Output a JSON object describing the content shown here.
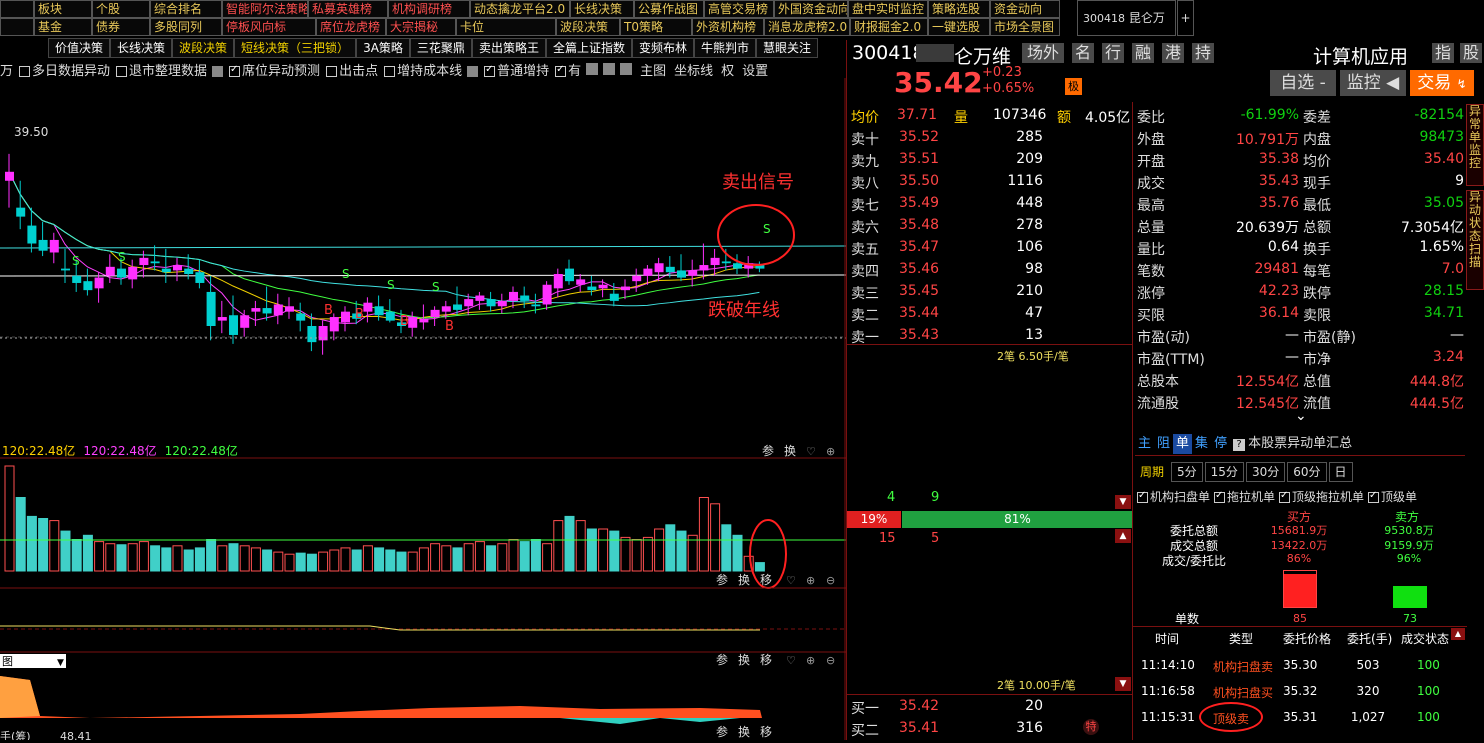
{
  "menu_row1": [
    "",
    "板块",
    "个股",
    "综合排名",
    "智能阿尔法策略",
    "私募英雄榜",
    "机构调研榜",
    "动态擒龙平台2.0",
    "长线决策",
    "公募作战图",
    "高管交易榜",
    "外国资金动向",
    "盘中实时监控",
    "策略选股",
    "资金动向"
  ],
  "menu_row2": [
    "",
    "基金",
    "债券",
    "多股同列",
    "停板风向标",
    "席位龙虎榜",
    "大宗揭秘",
    "卡位",
    "波段决策",
    "T0策略",
    "外资机构榜",
    "消息龙虎榜2.0",
    "财报掘金2.0",
    "一键选股",
    "市场全景图"
  ],
  "menu_red_row1": [
    4,
    5,
    6
  ],
  "menu_red_row2": [
    4,
    5,
    6
  ],
  "stock_tab": {
    "code": "300418",
    "name": "昆仑万维",
    "plus": "+"
  },
  "strategy_buttons": [
    "价值决策",
    "长线决策",
    "波段决策",
    "短线决策（三把锁）",
    "3A策略",
    "三花聚鼎",
    "卖出策略王",
    "全篇上证指数",
    "变频布林",
    "牛熊判市",
    "慧眼关注"
  ],
  "strategy_yellow": [
    2,
    3
  ],
  "options": [
    {
      "label": "多日数据异动",
      "on": false
    },
    {
      "label": "退市整理数据",
      "on": false
    },
    {
      "label": "席位异动预测",
      "on": true
    },
    {
      "label": "出击点",
      "on": false
    },
    {
      "label": "增持成本线",
      "on": false
    },
    {
      "label": "普通增持",
      "on": true
    },
    {
      "label": "有",
      "on": true
    }
  ],
  "options_tail": [
    "主图",
    "坐标线",
    "权",
    "设置"
  ],
  "options_lead": "万",
  "chart": {
    "high_label": "39.50",
    "annot_sell": "卖出信号",
    "annot_break": "跌破年线",
    "volume_legend": [
      "120:22.48亿",
      "120:22.48亿",
      "120:22.48亿"
    ],
    "panel_tools": [
      "参",
      "换",
      "移"
    ],
    "panel_tools2": [
      "参",
      "换"
    ],
    "dropdown": "图",
    "bottom_cut": "手(筹)",
    "bottom_val": "48.41"
  },
  "chart_data": {
    "type": "candlestick",
    "candles": [
      [
        42.5,
        44,
        41,
        43
      ],
      [
        41,
        42.5,
        39.8,
        40.5
      ],
      [
        40,
        41,
        38.5,
        39
      ],
      [
        39.2,
        40.2,
        38.3,
        38.6
      ],
      [
        38.5,
        39.6,
        37.9,
        39.2
      ],
      [
        37.6,
        38.7,
        36.8,
        37.5
      ],
      [
        37.2,
        38.1,
        36.3,
        36.8
      ],
      [
        36.9,
        37.6,
        36.1,
        36.4
      ],
      [
        36.5,
        37.4,
        35.7,
        37.1
      ],
      [
        37.2,
        38.4,
        36.8,
        37.7
      ],
      [
        37.6,
        38.2,
        36.7,
        37.1
      ],
      [
        37,
        38.1,
        36.5,
        37.7
      ],
      [
        37.8,
        38.6,
        37.1,
        38.2
      ],
      [
        38,
        38.9,
        37.5,
        37.9
      ],
      [
        37.6,
        38.7,
        36.8,
        37.4
      ],
      [
        37.5,
        38.2,
        36.9,
        37.8
      ],
      [
        37.6,
        38.4,
        37,
        37.3
      ],
      [
        37.4,
        38.1,
        36.5,
        36.8
      ],
      [
        36.3,
        37.2,
        33.6,
        34.4
      ],
      [
        34.7,
        35.8,
        34,
        34.9
      ],
      [
        35,
        36.1,
        33.4,
        33.9
      ],
      [
        34.3,
        35.3,
        33.8,
        35
      ],
      [
        35.2,
        35.8,
        34.4,
        35.4
      ],
      [
        35.4,
        36.6,
        34.7,
        35.1
      ],
      [
        35,
        36.2,
        34.5,
        35.6
      ],
      [
        35.2,
        36,
        34.8,
        35.5
      ],
      [
        35.1,
        35.7,
        34.1,
        34.7
      ],
      [
        34.4,
        35.1,
        33,
        33.5
      ],
      [
        33.6,
        34.7,
        32.8,
        34.4
      ],
      [
        34.1,
        35.1,
        33.6,
        34.9
      ],
      [
        34.6,
        35.5,
        34.1,
        35.2
      ],
      [
        35.1,
        35.8,
        34.5,
        34.8
      ],
      [
        35.2,
        36,
        34.6,
        35.7
      ],
      [
        35.5,
        36.1,
        34.7,
        35
      ],
      [
        35.2,
        35.9,
        34.6,
        34.7
      ],
      [
        34.6,
        35.3,
        34,
        34.4
      ],
      [
        34.3,
        35.2,
        33.8,
        34.9
      ],
      [
        34.6,
        35.6,
        34.2,
        34.8
      ],
      [
        34.9,
        35.5,
        34.4,
        35.3
      ],
      [
        35.2,
        35.8,
        34.8,
        35.5
      ],
      [
        35.6,
        36.6,
        35,
        35.3
      ],
      [
        35.5,
        36.2,
        35,
        35.9
      ],
      [
        35.8,
        36.3,
        35.3,
        36.1
      ],
      [
        35.9,
        36.3,
        35.2,
        35.5
      ],
      [
        35.5,
        36.2,
        35.1,
        35.8
      ],
      [
        35.8,
        36.6,
        35.4,
        36.3
      ],
      [
        36.1,
        36.6,
        35.4,
        35.8
      ],
      [
        35.6,
        36.2,
        35.1,
        35.5
      ],
      [
        35.6,
        36.9,
        35.3,
        36.7
      ],
      [
        36.5,
        37.6,
        36,
        37.3
      ],
      [
        37.6,
        38.1,
        36.7,
        36.9
      ],
      [
        36.7,
        37.3,
        36.3,
        37
      ],
      [
        36.6,
        37.2,
        36.1,
        36.4
      ],
      [
        36.5,
        37,
        36,
        36.7
      ],
      [
        36.2,
        36.8,
        35.5,
        35.8
      ],
      [
        36.4,
        37,
        35.9,
        36.6
      ],
      [
        36.9,
        37.6,
        36.3,
        37.2
      ],
      [
        37.2,
        37.8,
        36.7,
        37.6
      ],
      [
        37.4,
        38.2,
        36.9,
        37.9
      ],
      [
        37.7,
        38.3,
        37.1,
        37.4
      ],
      [
        37.5,
        38.4,
        36.9,
        37.1
      ],
      [
        37.2,
        38.1,
        36.6,
        37.5
      ],
      [
        37.5,
        39,
        37,
        37.8
      ],
      [
        37.8,
        38.7,
        37.2,
        38.2
      ],
      [
        38,
        38.7,
        37.5,
        37.9
      ],
      [
        37.9,
        38.4,
        37.3,
        37.6
      ],
      [
        37.6,
        38.3,
        37.1,
        37.9
      ],
      [
        37.8,
        38,
        37.4,
        37.6
      ]
    ],
    "volumes": [
      100,
      70,
      52,
      50,
      48,
      38,
      30,
      34,
      28,
      26,
      25,
      26,
      28,
      24,
      22,
      24,
      20,
      22,
      30,
      24,
      26,
      24,
      22,
      20,
      18,
      16,
      17,
      16,
      18,
      20,
      22,
      20,
      24,
      22,
      20,
      18,
      18,
      22,
      26,
      24,
      22,
      26,
      28,
      24,
      26,
      30,
      28,
      30,
      26,
      48,
      52,
      48,
      40,
      40,
      38,
      32,
      30,
      32,
      40,
      44,
      38,
      34,
      70,
      64,
      44,
      34,
      14,
      8
    ],
    "ylabel_high": "39.50"
  },
  "orderbook": {
    "avg_label": "均价",
    "avg": "37.71",
    "vol_label": "量",
    "vol": "107346",
    "amt_label": "额",
    "amt": "4.05亿",
    "asks": [
      {
        "l": "卖十",
        "p": "35.52",
        "v": "285"
      },
      {
        "l": "卖九",
        "p": "35.51",
        "v": "209"
      },
      {
        "l": "卖八",
        "p": "35.50",
        "v": "1116"
      },
      {
        "l": "卖七",
        "p": "35.49",
        "v": "448"
      },
      {
        "l": "卖六",
        "p": "35.48",
        "v": "278"
      },
      {
        "l": "卖五",
        "p": "35.47",
        "v": "106"
      },
      {
        "l": "卖四",
        "p": "35.46",
        "v": "98"
      },
      {
        "l": "卖三",
        "p": "35.45",
        "v": "210"
      },
      {
        "l": "卖二",
        "p": "35.44",
        "v": "47"
      },
      {
        "l": "卖一",
        "p": "35.43",
        "v": "13"
      }
    ],
    "note1": "2笔 6.50手/笔",
    "c1a": "4",
    "c1b": "9",
    "pct_buy": "19%",
    "pct_sell": "81%",
    "c2a": "15",
    "c2b": "5",
    "note2": "2笔 10.00手/笔",
    "bids": [
      {
        "l": "买一",
        "p": "35.42",
        "v": "20"
      },
      {
        "l": "买二",
        "p": "35.41",
        "v": "316"
      }
    ],
    "bid_tag": "特"
  },
  "header": {
    "code": "300418",
    "name_tail": "仑万维",
    "buttons": [
      "场外",
      "名",
      "行",
      "融",
      "港",
      "持"
    ],
    "industry": "计算机应用",
    "btn_zhi": "指",
    "btn_fu": "股",
    "price": "35.42",
    "chg": "+0.23",
    "pct": "+0.65%",
    "flag": "极",
    "btn_watch": "自选",
    "btn_monitor": "监控",
    "btn_trade": "交易"
  },
  "stats": [
    [
      "委比",
      "-61.99%",
      "委差",
      "-82154",
      "g",
      "g"
    ],
    [
      "外盘",
      "10.791万",
      "内盘",
      "98473",
      "r",
      "g"
    ],
    [
      "开盘",
      "35.38",
      "均价",
      "35.40",
      "r",
      "r"
    ],
    [
      "成交",
      "35.43",
      "现手",
      "9",
      "r",
      "w"
    ],
    [
      "最高",
      "35.76",
      "最低",
      "35.05",
      "r",
      "g"
    ],
    [
      "总量",
      "20.639万",
      "总额",
      "7.3054亿",
      "w",
      "w"
    ],
    [
      "量比",
      "0.64",
      "换手",
      "1.65%",
      "w",
      "w"
    ],
    [
      "笔数",
      "29481",
      "每笔",
      "7.0",
      "r",
      "r"
    ],
    [
      "涨停",
      "42.23",
      "跌停",
      "28.15",
      "r",
      "g"
    ],
    [
      "买限",
      "36.14",
      "卖限",
      "34.71",
      "r",
      "g"
    ],
    [
      "市盈(动)",
      "—",
      "市盈(静)",
      "—",
      "w",
      "w"
    ],
    [
      "市盈(TTM)",
      "—",
      "市净",
      "3.24",
      "w",
      "r"
    ],
    [
      "总股本",
      "12.554亿",
      "总值",
      "444.8亿",
      "r",
      "r"
    ],
    [
      "流通股",
      "12.545亿",
      "流值",
      "444.5亿",
      "r",
      "r"
    ]
  ],
  "side_tabs": [
    "异常单监控",
    "异动状态扫描"
  ],
  "lower": {
    "tabs": [
      "主",
      "阻",
      "单",
      "集",
      "停"
    ],
    "summary": "本股票异动单汇总",
    "periods": [
      "周期",
      "5分",
      "15分",
      "30分",
      "60分",
      "日"
    ],
    "checks": [
      "机构扫盘单",
      "拖拉机单",
      "顶级拖拉机单",
      "顶级单"
    ],
    "buy_h": "买方",
    "sell_h": "卖方",
    "rows": [
      [
        "委托总额",
        "15681.9万",
        "9530.8万"
      ],
      [
        "成交总额",
        "13422.0万",
        "9159.9万"
      ],
      [
        "成交/委托比",
        "86%",
        "96%"
      ]
    ],
    "count_label": "单数",
    "buy_count": "85",
    "sell_count": "73",
    "buy_fill": 0.86,
    "sell_fill": 0.96,
    "th": [
      "时间",
      "类型",
      "委托价格",
      "委托(手)",
      "成交状态"
    ],
    "trades": [
      [
        "11:14:10",
        "机构扫盘卖",
        "35.30",
        "503",
        "100"
      ],
      [
        "11:16:58",
        "机构扫盘买",
        "35.32",
        "320",
        "100"
      ],
      [
        "11:15:31",
        "顶级卖",
        "35.31",
        "1,027",
        "100"
      ]
    ]
  }
}
